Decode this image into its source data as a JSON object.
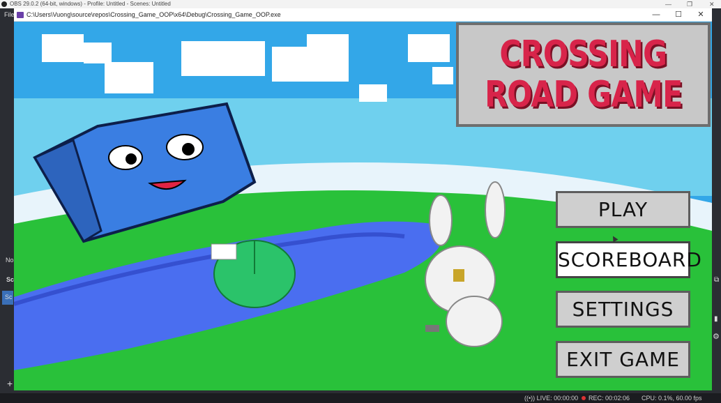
{
  "obs": {
    "title": "OBS 29.0.2 (64-bit, windows) - Profile: Untitled - Scenes: Untitled",
    "menu_partial": "File",
    "side_labels": [
      "No",
      "Sc",
      "Sc"
    ],
    "add_symbol": "+",
    "status": {
      "live": "LIVE: 00:00:00",
      "rec": "REC: 00:02:06",
      "cpu": "CPU: 0.1%, 60.00 fps"
    }
  },
  "game_window": {
    "title": "C:\\Users\\Vuong\\source\\repos\\Crossing_Game_OOP\\x64\\Debug\\Crossing_Game_OOP.exe",
    "minimize": "—",
    "maximize": "☐",
    "close": "✕"
  },
  "game": {
    "logo_line1": "CROSSING",
    "logo_line2": "ROAD GAME",
    "menu": [
      "PLAY",
      "SCOREBOARD",
      "SETTINGS",
      "EXIT GAME"
    ],
    "selected_index": 1
  },
  "colors": {
    "sky": "#33a7e8",
    "grass": "#29c13a",
    "river": "#4a6ef0",
    "logo_red": "#d8244a"
  }
}
